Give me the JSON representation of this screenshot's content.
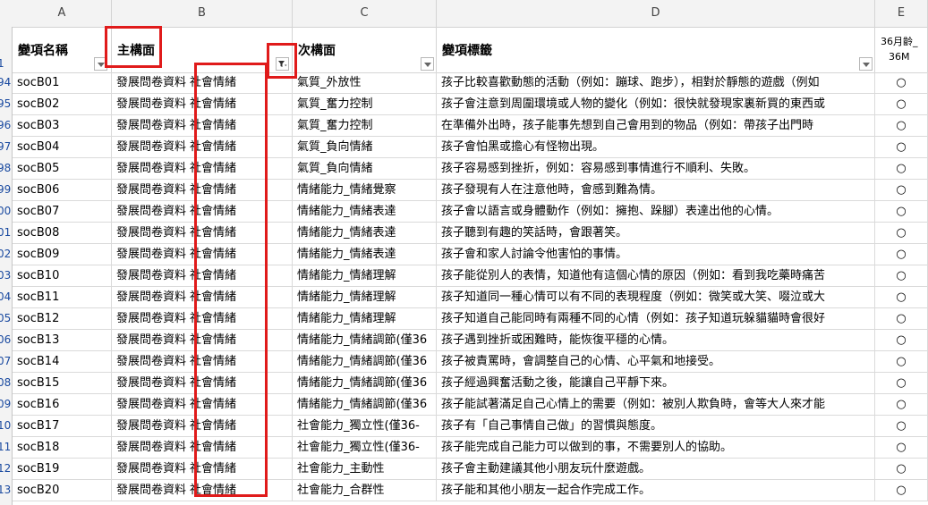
{
  "columns": [
    {
      "letter": "A"
    },
    {
      "letter": "B"
    },
    {
      "letter": "C"
    },
    {
      "letter": "D"
    },
    {
      "letter": "E"
    }
  ],
  "header_row": {
    "row_label": "1",
    "a": "變項名稱",
    "b": "主構面",
    "c": "次構面",
    "d": "變項標籤",
    "e_line1": "36月齡_",
    "e_line2": "36M"
  },
  "rows": [
    {
      "n": "94",
      "a": "socB01",
      "b1": "發展問卷資料",
      "b2": "社會情緒",
      "c": "氣質_外放性",
      "d": "孩子比較喜歡動態的活動（例如：蹦球、跑步），相對於靜態的遊戲（例如",
      "e": "○"
    },
    {
      "n": "95",
      "a": "socB02",
      "b1": "發展問卷資料",
      "b2": "社會情緒",
      "c": "氣質_奮力控制",
      "d": "孩子會注意到周圍環境或人物的變化（例如：很快就發現家裏新買的東西或",
      "e": "○"
    },
    {
      "n": "96",
      "a": "socB03",
      "b1": "發展問卷資料",
      "b2": "社會情緒",
      "c": "氣質_奮力控制",
      "d": "在準備外出時，孩子能事先想到自己會用到的物品（例如：帶孩子出門時",
      "e": "○"
    },
    {
      "n": "97",
      "a": "socB04",
      "b1": "發展問卷資料",
      "b2": "社會情緒",
      "c": "氣質_負向情緒",
      "d": "孩子會怕黑或擔心有怪物出現。",
      "e": "○"
    },
    {
      "n": "98",
      "a": "socB05",
      "b1": "發展問卷資料",
      "b2": "社會情緒",
      "c": "氣質_負向情緒",
      "d": "孩子容易感到挫折，例如：容易感到事情進行不順利、失敗。",
      "e": "○"
    },
    {
      "n": "99",
      "a": "socB06",
      "b1": "發展問卷資料",
      "b2": "社會情緒",
      "c": "情緒能力_情緒覺察",
      "d": "孩子發現有人在注意他時，會感到難為情。",
      "e": "○"
    },
    {
      "n": "00",
      "a": "socB07",
      "b1": "發展問卷資料",
      "b2": "社會情緒",
      "c": "情緒能力_情緒表達",
      "d": "孩子會以語言或身體動作（例如：擁抱、跺腳）表達出他的心情。",
      "e": "○"
    },
    {
      "n": "01",
      "a": "socB08",
      "b1": "發展問卷資料",
      "b2": "社會情緒",
      "c": "情緒能力_情緒表達",
      "d": "孩子聽到有趣的笑話時，會跟著笑。",
      "e": "○"
    },
    {
      "n": "02",
      "a": "socB09",
      "b1": "發展問卷資料",
      "b2": "社會情緒",
      "c": "情緒能力_情緒表達",
      "d": "孩子會和家人討論令他害怕的事情。",
      "e": "○"
    },
    {
      "n": "03",
      "a": "socB10",
      "b1": "發展問卷資料",
      "b2": "社會情緒",
      "c": "情緒能力_情緒理解",
      "d": "孩子能從別人的表情，知道他有這個心情的原因（例如：看到我吃藥時痛苦",
      "e": "○"
    },
    {
      "n": "04",
      "a": "socB11",
      "b1": "發展問卷資料",
      "b2": "社會情緒",
      "c": "情緒能力_情緒理解",
      "d": "孩子知道同一種心情可以有不同的表現程度（例如：微笑或大笑、啜泣或大",
      "e": "○"
    },
    {
      "n": "05",
      "a": "socB12",
      "b1": "發展問卷資料",
      "b2": "社會情緒",
      "c": "情緒能力_情緒理解",
      "d": "孩子知道自己能同時有兩種不同的心情（例如：孩子知道玩躲貓貓時會很好",
      "e": "○"
    },
    {
      "n": "06",
      "a": "socB13",
      "b1": "發展問卷資料",
      "b2": "社會情緒",
      "c": "情緒能力_情緒調節(僅36",
      "d": "孩子遇到挫折或困難時，能恢復平穩的心情。",
      "e": "○"
    },
    {
      "n": "07",
      "a": "socB14",
      "b1": "發展問卷資料",
      "b2": "社會情緒",
      "c": "情緒能力_情緒調節(僅36",
      "d": "孩子被責罵時，會調整自己的心情、心平氣和地接受。",
      "e": "○"
    },
    {
      "n": "08",
      "a": "socB15",
      "b1": "發展問卷資料",
      "b2": "社會情緒",
      "c": "情緒能力_情緒調節(僅36",
      "d": "孩子經過興奮活動之後，能讓自己平靜下來。",
      "e": "○"
    },
    {
      "n": "09",
      "a": "socB16",
      "b1": "發展問卷資料",
      "b2": "社會情緒",
      "c": "情緒能力_情緒調節(僅36",
      "d": "孩子能試著滿足自己心情上的需要（例如：被別人欺負時，會等大人來才能",
      "e": "○"
    },
    {
      "n": "10",
      "a": "socB17",
      "b1": "發展問卷資料",
      "b2": "社會情緒",
      "c": "社會能力_獨立性(僅36-",
      "d": "孩子有「自己事情自己做」的習慣與態度。",
      "e": "○"
    },
    {
      "n": "11",
      "a": "socB18",
      "b1": "發展問卷資料",
      "b2": "社會情緒",
      "c": "社會能力_獨立性(僅36-",
      "d": "孩子能完成自己能力可以做到的事，不需要別人的協助。",
      "e": "○"
    },
    {
      "n": "12",
      "a": "socB19",
      "b1": "發展問卷資料",
      "b2": "社會情緒",
      "c": "社會能力_主動性",
      "d": "孩子會主動建議其他小朋友玩什麼遊戲。",
      "e": "○"
    },
    {
      "n": "13",
      "a": "socB20",
      "b1": "發展問卷資料",
      "b2": "社會情緒",
      "c": "社會能力_合群性",
      "d": "孩子能和其他小朋友一起合作完成工作。",
      "e": "○"
    }
  ],
  "icons": {
    "filter_dropdown": "chevron-down-icon",
    "filter_active": "funnel-filter-icon"
  },
  "colors": {
    "highlight_box": "#e01b1b",
    "row_number": "#1a4aa0"
  }
}
